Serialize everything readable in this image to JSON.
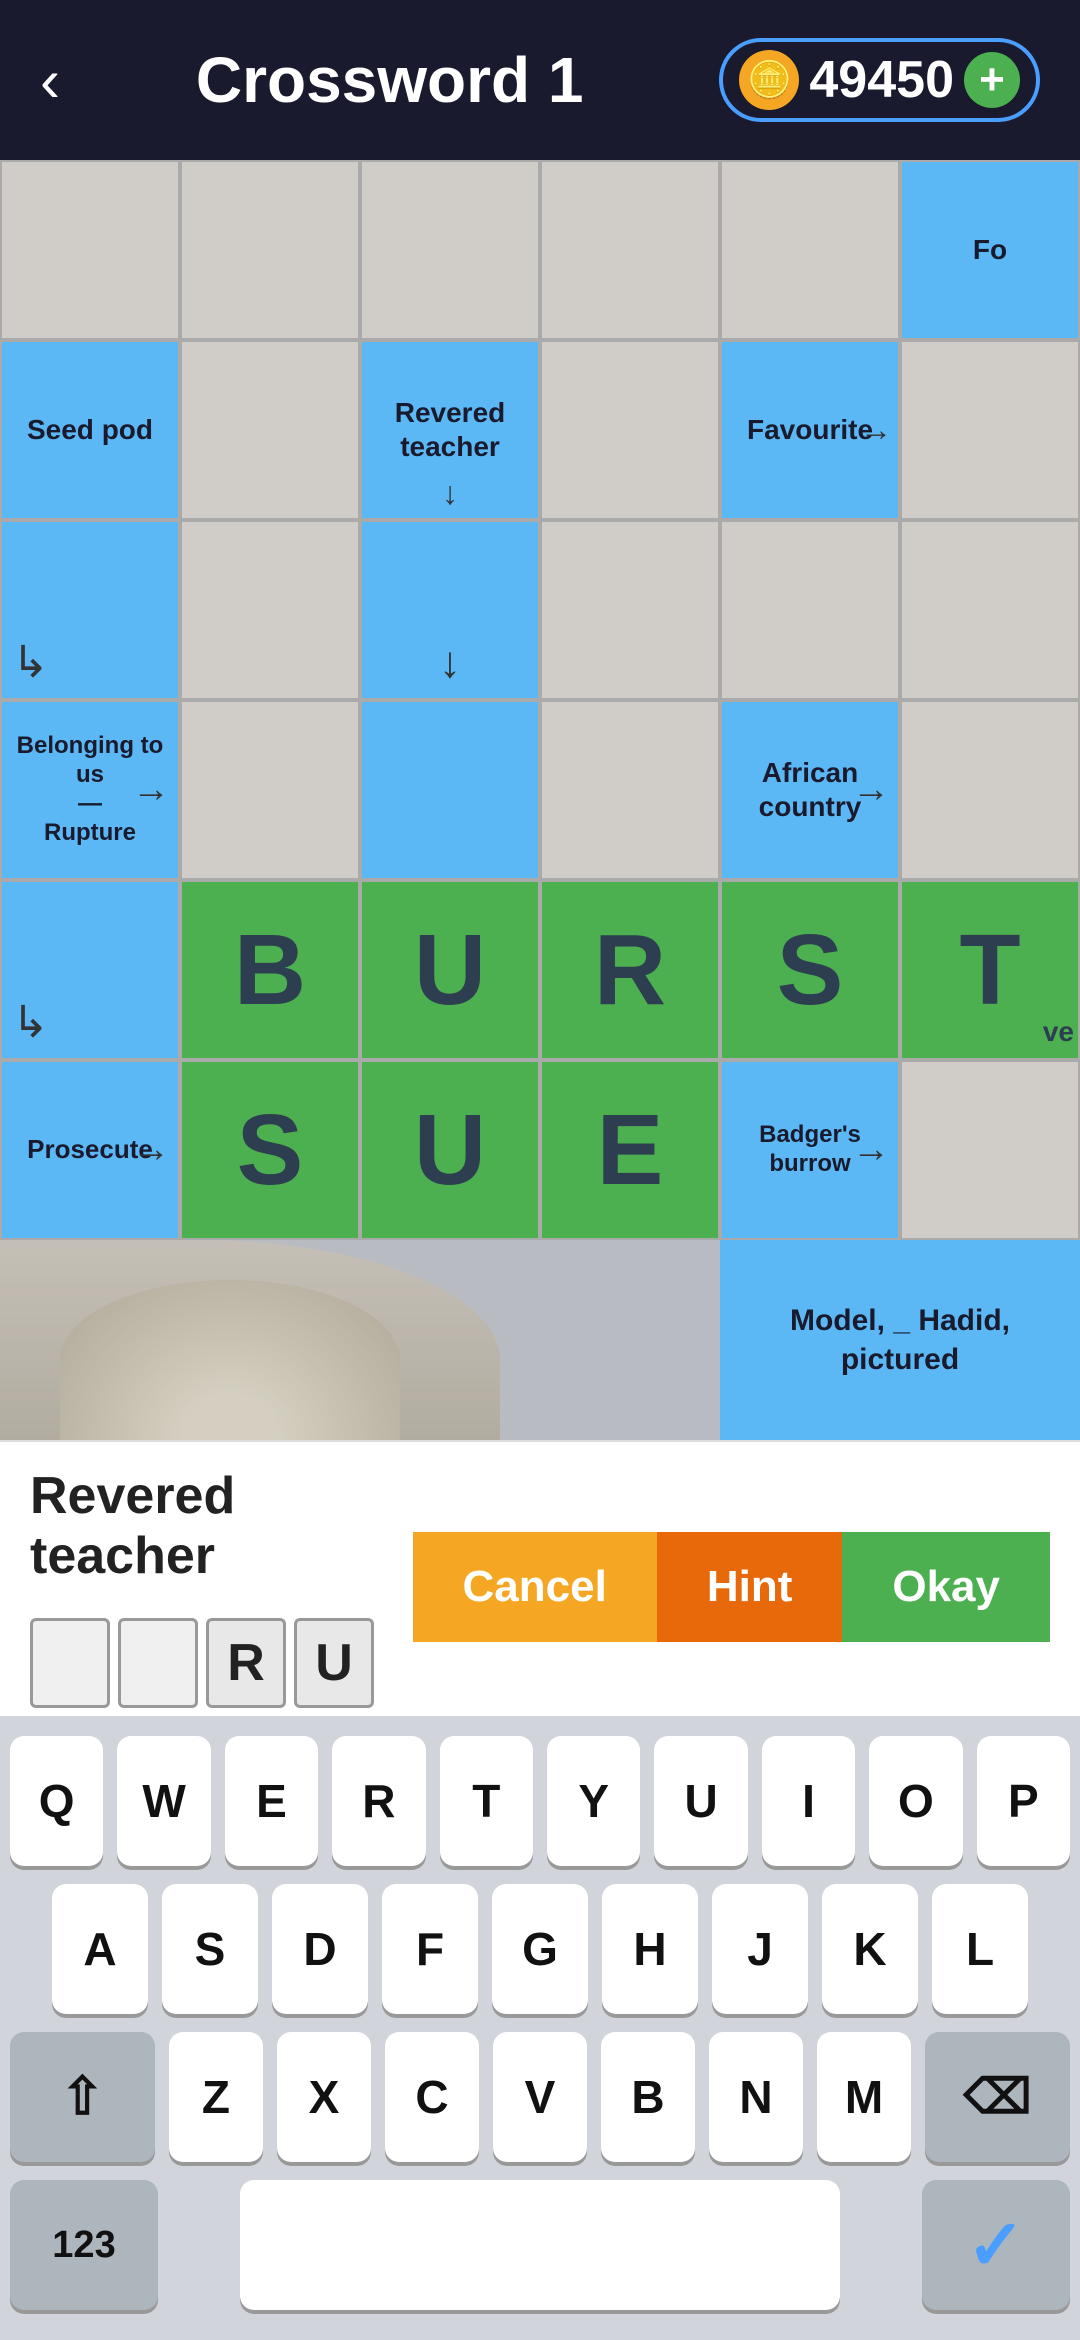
{
  "header": {
    "back_label": "‹",
    "title": "Crossword 1",
    "coin_icon": "🪙",
    "coin_amount": "49450",
    "coin_add": "+"
  },
  "grid": {
    "rows": [
      [
        {
          "type": "empty"
        },
        {
          "type": "empty"
        },
        {
          "type": "empty"
        },
        {
          "type": "empty"
        },
        {
          "type": "empty"
        },
        {
          "type": "clue_blue",
          "text": "Fo"
        }
      ],
      [
        {
          "type": "clue_blue",
          "text": "Seed pod"
        },
        {
          "type": "empty"
        },
        {
          "type": "clue_blue",
          "text": "Revered teacher",
          "arrow": "down"
        },
        {
          "type": "empty"
        },
        {
          "type": "clue_blue",
          "text": "Favourite",
          "arrow": "right"
        },
        {
          "type": "empty"
        }
      ],
      [
        {
          "type": "clue_blue",
          "text": "↳",
          "arrow_corner": true
        },
        {
          "type": "empty"
        },
        {
          "type": "clue_blue",
          "arrow": "down"
        },
        {
          "type": "empty"
        },
        {
          "type": "empty"
        },
        {
          "type": "empty"
        }
      ],
      [
        {
          "type": "clue_blue",
          "text": "Belonging to us\n—\nRupture",
          "arrow": "right"
        },
        {
          "type": "empty"
        },
        {
          "type": "clue_blue"
        },
        {
          "type": "empty"
        },
        {
          "type": "clue_blue",
          "text": "African country",
          "arrow": "right"
        },
        {
          "type": "empty"
        }
      ],
      [
        {
          "type": "clue_blue",
          "text": "↳"
        },
        {
          "type": "letter_green",
          "letter": "B"
        },
        {
          "type": "letter_green",
          "letter": "U"
        },
        {
          "type": "letter_green",
          "letter": "R"
        },
        {
          "type": "letter_green",
          "letter": "S"
        },
        {
          "type": "letter_green",
          "letter": "T",
          "partial": "ve"
        }
      ],
      [
        {
          "type": "clue_blue",
          "text": "Prosecute",
          "arrow": "right"
        },
        {
          "type": "letter_green",
          "letter": "S"
        },
        {
          "type": "letter_green",
          "letter": "U"
        },
        {
          "type": "letter_green",
          "letter": "E"
        },
        {
          "type": "clue_blue",
          "text": "Badger's burrow",
          "arrow": "right"
        },
        {
          "type": "empty"
        }
      ]
    ]
  },
  "photo": {
    "description": "blurred person photo"
  },
  "clue_bar": {
    "clue_text": "Revered teacher",
    "answer_boxes": [
      "",
      "",
      "R",
      "U"
    ],
    "btn_cancel": "Cancel",
    "btn_hint": "Hint",
    "btn_okay": "Okay"
  },
  "keyboard": {
    "row1": [
      "Q",
      "W",
      "E",
      "R",
      "T",
      "Y",
      "U",
      "I",
      "O",
      "P"
    ],
    "row2": [
      "A",
      "S",
      "D",
      "F",
      "G",
      "H",
      "J",
      "K",
      "L"
    ],
    "row3_shift": "⇧",
    "row3": [
      "Z",
      "X",
      "C",
      "V",
      "B",
      "N",
      "M"
    ],
    "row3_backspace": "⌫",
    "bottom_123": "123",
    "bottom_space": "",
    "bottom_done": "✓"
  }
}
